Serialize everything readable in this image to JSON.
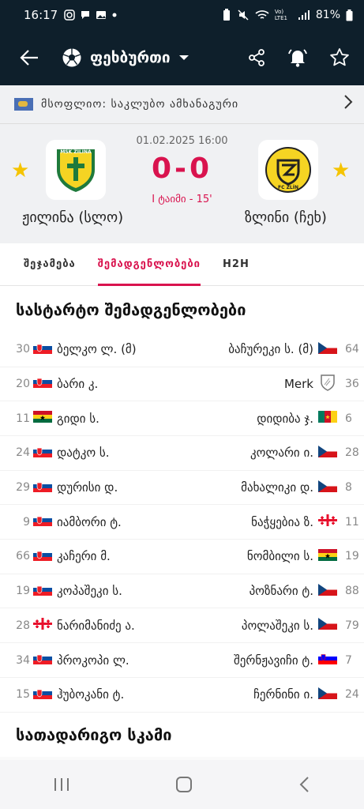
{
  "status_bar": {
    "time": "16:17",
    "battery": "81%",
    "network": "Vo) LTE1",
    "icons": [
      "instagram-icon",
      "chat-icon",
      "gallery-icon",
      "dot-icon",
      "battery-saver-icon",
      "mute-icon",
      "wifi-icon",
      "signal-icon",
      "battery-icon"
    ]
  },
  "app_bar": {
    "sport": "ფეხბურთი",
    "icons": [
      "back-arrow-icon",
      "soccer-ball-icon",
      "dropdown-icon",
      "share-icon",
      "bell-icon",
      "star-icon"
    ]
  },
  "competition": {
    "label": "მსოფლიო: საკლუბო ამხანაგური"
  },
  "match": {
    "datetime": "01.02.2025 16:00",
    "score": "0-0",
    "status": "I ტაიმი - 15'",
    "home": {
      "name": "ჟილინა (სლო)",
      "logo_text": "MŠK ŽILINA"
    },
    "away": {
      "name": "ზლინი (ჩეხ)",
      "logo_text": "FC ZLÍN"
    },
    "colors": {
      "accent": "#d9134e",
      "star": "#f5c400",
      "header": "#0e1f2b"
    }
  },
  "tabs": [
    {
      "label": "შეჯამება",
      "active": false
    },
    {
      "label": "შემადგენლობები",
      "active": true
    },
    {
      "label": "H2H",
      "active": false
    }
  ],
  "lineups": {
    "starting_title": "სასტარტო შემადგენლობები",
    "bench_title": "სათადარიგო სკამი",
    "rows": [
      {
        "home_num": "30",
        "home_flag": "SVK",
        "home_name": "ბელკო ლ. (მ)",
        "away_name": "ბაჩურეკი ს. (მ)",
        "away_flag": "CZE",
        "away_num": "64"
      },
      {
        "home_num": "20",
        "home_flag": "SVK",
        "home_name": "ბარი კ.",
        "away_name": "Merk",
        "away_flag": "NONE",
        "away_num": "36"
      },
      {
        "home_num": "11",
        "home_flag": "GHA",
        "home_name": "გიდი ს.",
        "away_name": "დიდიბა ჯ.",
        "away_flag": "CMR",
        "away_num": "6"
      },
      {
        "home_num": "24",
        "home_flag": "SVK",
        "home_name": "დატკო ს.",
        "away_name": "კოლარი ი.",
        "away_flag": "CZE",
        "away_num": "28"
      },
      {
        "home_num": "29",
        "home_flag": "SVK",
        "home_name": "დურისი დ.",
        "away_name": "მახალიკი დ.",
        "away_flag": "CZE",
        "away_num": "8"
      },
      {
        "home_num": "9",
        "home_flag": "SVK",
        "home_name": "იამბორი ტ.",
        "away_name": "ნაჭყებია ზ.",
        "away_flag": "GEO",
        "away_num": "11"
      },
      {
        "home_num": "66",
        "home_flag": "SVK",
        "home_name": "კაჩერი მ.",
        "away_name": "ნომბილი ს.",
        "away_flag": "GHA",
        "away_num": "19"
      },
      {
        "home_num": "19",
        "home_flag": "SVK",
        "home_name": "კოპაშეკი ს.",
        "away_name": "პოზნარი ტ.",
        "away_flag": "CZE",
        "away_num": "88"
      },
      {
        "home_num": "28",
        "home_flag": "GEO",
        "home_name": "ნარიმანიძე ა.",
        "away_name": "პოლაშეკი ს.",
        "away_flag": "CZE",
        "away_num": "79"
      },
      {
        "home_num": "34",
        "home_flag": "SVK",
        "home_name": "პროკოპი ლ.",
        "away_name": "შერნჟავიჩი ტ.",
        "away_flag": "SVN",
        "away_num": "7"
      },
      {
        "home_num": "15",
        "home_flag": "SVK",
        "home_name": "ჰუბოკანი ტ.",
        "away_name": "ჩერნინი ი.",
        "away_flag": "CZE",
        "away_num": "24"
      }
    ]
  },
  "nav_bar": {
    "icons": [
      "recent-apps-icon",
      "home-icon",
      "back-icon"
    ]
  }
}
